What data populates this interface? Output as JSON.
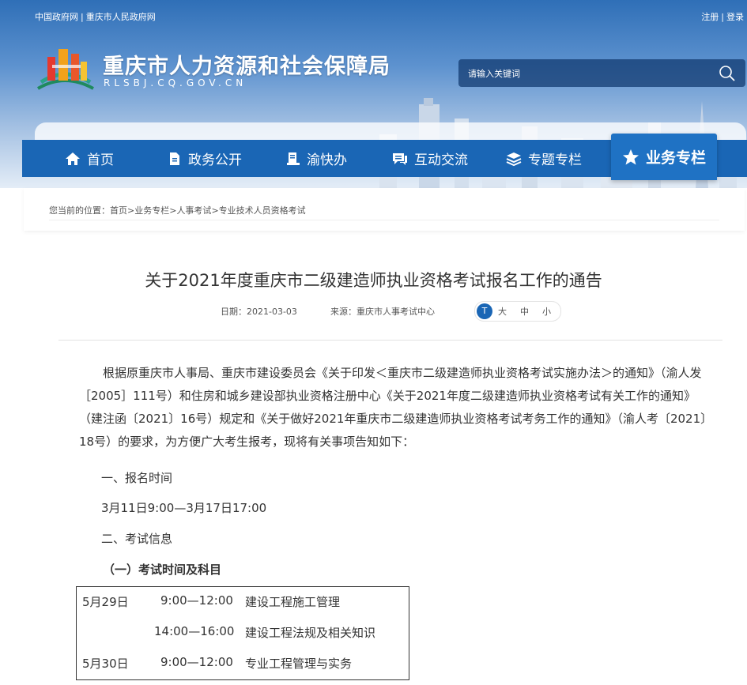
{
  "topbar": {
    "links": [
      "中国政府网",
      "重庆市人民政府网"
    ],
    "separator": "|",
    "register": "注册",
    "login": "登录"
  },
  "site": {
    "title": "重庆市人力资源和社会保障局",
    "url": "RLSBJ.CQ.GOV.CN"
  },
  "search": {
    "placeholder": "请输入关键词",
    "icon": "search-icon"
  },
  "nav": {
    "items": [
      {
        "label": "首页",
        "icon": "home-icon"
      },
      {
        "label": "政务公开",
        "icon": "document-icon"
      },
      {
        "label": "渝快办",
        "icon": "service-icon"
      },
      {
        "label": "互动交流",
        "icon": "chat-icon"
      },
      {
        "label": "专题专栏",
        "icon": "layers-icon"
      },
      {
        "label": "业务专栏",
        "icon": "star-icon",
        "active": true
      }
    ],
    "color": "#1a66b5"
  },
  "breadcrumb": {
    "prefix": "您当前的位置：",
    "items": [
      "首页",
      "业务专栏",
      "人事考试",
      "专业技术人员资格考试"
    ],
    "separator": ">"
  },
  "article": {
    "title": "关于2021年度重庆市二级建造师执业资格考试报名工作的通告",
    "date": "日期：2021-03-03",
    "source": "来源：重庆市人事考试中心",
    "fontsize": {
      "badge": "T",
      "large": "大",
      "medium": "中",
      "small": "小"
    },
    "intro": "根据原重庆市人事局、重庆市建设委员会《关于印发＜重庆市二级建造师执业资格考试实施办法＞的通知》（渝人发［2005］111号）和住房和城乡建设部执业资格注册中心《关于2021年度二级建造师执业资格考试有关工作的通知》（建注函〔2021〕16号）规定和《关于做好2021年重庆市二级建造师执业资格考试考务工作的通知》（渝人考〔2021〕18号）的要求，为方便广大考生报考，现将有关事项告知如下：",
    "section1": "一、报名时间",
    "reg_time": "3月11日9:00—3月17日17:00",
    "section2": "二、考试信息",
    "subsection1": "（一）考试时间及科目",
    "schedule": [
      {
        "date": "5月29日",
        "time": "9:00—12:00",
        "subject": "建设工程施工管理"
      },
      {
        "date": "",
        "time": "14:00—16:00",
        "subject": "建设工程法规及相关知识"
      },
      {
        "date": "5月30日",
        "time": "9:00—12:00",
        "subject": "专业工程管理与实务"
      }
    ]
  }
}
